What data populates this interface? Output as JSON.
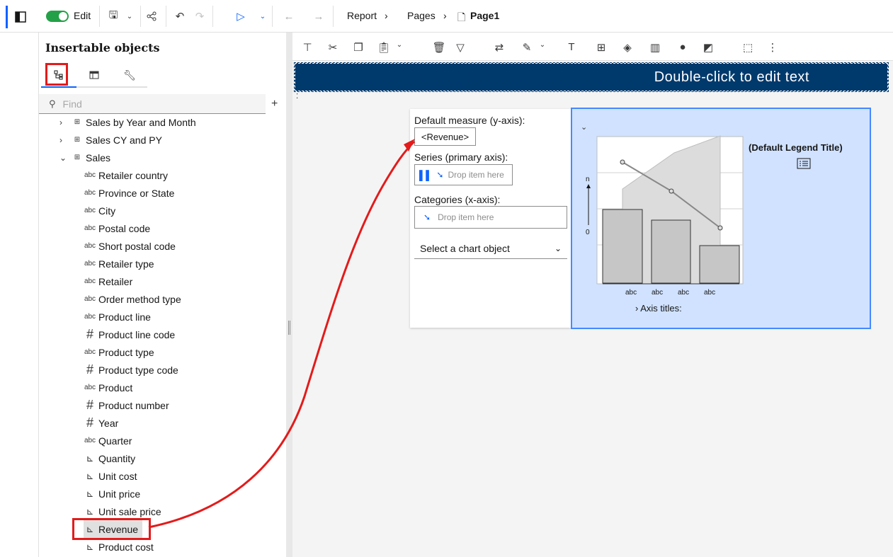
{
  "header": {
    "edit_label": "Edit",
    "breadcrumb": [
      "Report",
      "Pages",
      "Page1"
    ]
  },
  "panel": {
    "title": "Insertable objects",
    "find_placeholder": "Find",
    "tree": [
      {
        "label": "Sales by Year and Month",
        "type": "table",
        "expanded": false,
        "level": 0
      },
      {
        "label": "Sales CY and PY",
        "type": "table",
        "expanded": false,
        "level": 0
      },
      {
        "label": "Sales",
        "type": "table",
        "expanded": true,
        "level": 0
      },
      {
        "label": "Retailer country",
        "type": "text",
        "level": 1
      },
      {
        "label": "Province or State",
        "type": "text",
        "level": 1
      },
      {
        "label": "City",
        "type": "text",
        "level": 1
      },
      {
        "label": "Postal code",
        "type": "text",
        "level": 1
      },
      {
        "label": "Short postal code",
        "type": "text",
        "level": 1
      },
      {
        "label": "Retailer type",
        "type": "text",
        "level": 1
      },
      {
        "label": "Retailer",
        "type": "text",
        "level": 1
      },
      {
        "label": "Order method type",
        "type": "text",
        "level": 1
      },
      {
        "label": "Product line",
        "type": "text",
        "level": 1
      },
      {
        "label": "Product line code",
        "type": "number",
        "level": 1
      },
      {
        "label": "Product type",
        "type": "text",
        "level": 1
      },
      {
        "label": "Product type code",
        "type": "number",
        "level": 1
      },
      {
        "label": "Product",
        "type": "text",
        "level": 1
      },
      {
        "label": "Product number",
        "type": "number",
        "level": 1
      },
      {
        "label": "Year",
        "type": "number",
        "level": 1
      },
      {
        "label": "Quarter",
        "type": "text",
        "level": 1
      },
      {
        "label": "Quantity",
        "type": "measure",
        "level": 1
      },
      {
        "label": "Unit cost",
        "type": "measure",
        "level": 1
      },
      {
        "label": "Unit price",
        "type": "measure",
        "level": 1
      },
      {
        "label": "Unit sale price",
        "type": "measure",
        "level": 1
      },
      {
        "label": "Revenue",
        "type": "measure",
        "level": 1,
        "selected": true
      },
      {
        "label": "Product cost",
        "type": "measure",
        "level": 1
      }
    ],
    "icons": {
      "text": "abc",
      "number": "#",
      "measure": "⊾",
      "table": "⊞"
    }
  },
  "canvas": {
    "banner_text": "Double-click to edit text",
    "default_measure_label": "Default measure (y-axis):",
    "default_measure_value": "<Revenue>",
    "series_label": "Series (primary axis):",
    "series_drop": "Drop item here",
    "categories_label": "Categories (x-axis):",
    "categories_drop": "Drop item here",
    "chart_object_select": "Select a chart object",
    "legend_title": "(Default Legend Title)",
    "axis_titles": "Axis titles:",
    "y_axis_top": "n",
    "y_axis_zero": "0",
    "x_labels": [
      "abc",
      "abc",
      "abc",
      "abc"
    ]
  },
  "colors": {
    "accent": "#0f62fe",
    "banner": "#003a6d",
    "chart_bg": "#d0e2ff",
    "annotation": "#e31b1b",
    "toggle_on": "#24a148"
  }
}
